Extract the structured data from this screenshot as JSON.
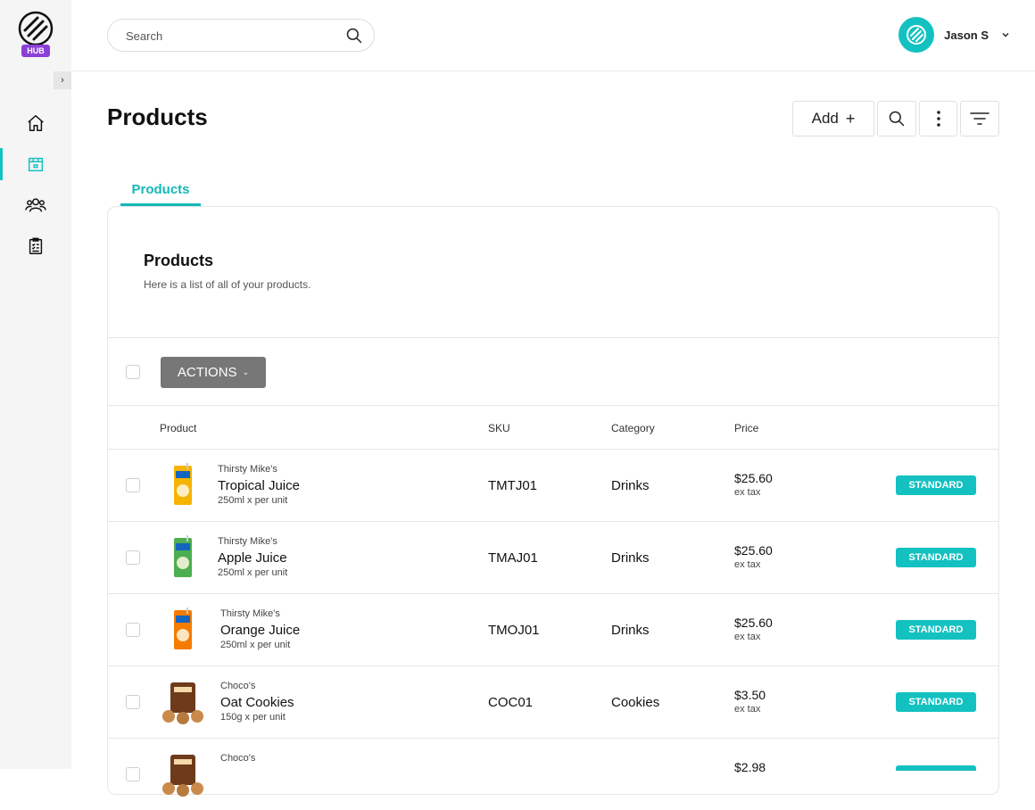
{
  "brand": {
    "logo_text": "HUB",
    "accent": "#14c1c1",
    "badge_purple": "#8b3fd6"
  },
  "sidebar": {
    "collapse_icon": "chevron-right-icon",
    "items": [
      {
        "name": "home",
        "icon": "home-icon",
        "active": false
      },
      {
        "name": "products",
        "icon": "package-icon",
        "active": true
      },
      {
        "name": "customers",
        "icon": "users-icon",
        "active": false
      },
      {
        "name": "orders",
        "icon": "clipboard-list-icon",
        "active": false
      }
    ]
  },
  "topbar": {
    "search_placeholder": "Search",
    "user_name": "Jason S"
  },
  "header": {
    "title": "Products",
    "add_label": "Add",
    "add_icon": "+"
  },
  "tabs": [
    {
      "label": "Products",
      "active": true
    }
  ],
  "card": {
    "title": "Products",
    "subtitle": "Here is a list of all of your products.",
    "actions_label": "ACTIONS",
    "columns": {
      "product": "Product",
      "sku": "SKU",
      "category": "Category",
      "price": "Price"
    }
  },
  "rows": [
    {
      "brand": "Thirsty Mike's",
      "name": "Tropical Juice",
      "unit": "250ml x per unit",
      "sku": "TMTJ01",
      "category": "Drinks",
      "price": "$25.60",
      "tax": "ex tax",
      "badge": "STANDARD",
      "thumb": "juice",
      "thumb_color": "#f4b400"
    },
    {
      "brand": "Thirsty Mike's",
      "name": "Apple Juice",
      "unit": "250ml x per unit",
      "sku": "TMAJ01",
      "category": "Drinks",
      "price": "$25.60",
      "tax": "ex tax",
      "badge": "STANDARD",
      "thumb": "juice",
      "thumb_color": "#4caf50"
    },
    {
      "brand": "Thirsty Mike's",
      "name": "Orange Juice",
      "unit": "250ml x per unit",
      "sku": "TMOJ01",
      "category": "Drinks",
      "price": "$25.60",
      "tax": "ex tax",
      "badge": "STANDARD",
      "thumb": "juice",
      "thumb_color": "#f57c00"
    },
    {
      "brand": "Choco's",
      "name": "Oat Cookies",
      "unit": "150g x per unit",
      "sku": "COC01",
      "category": "Cookies",
      "price": "$3.50",
      "tax": "ex tax",
      "badge": "STANDARD",
      "thumb": "cookies",
      "thumb_color": "#6d3b1c"
    },
    {
      "brand": "Choco's",
      "name": "",
      "unit": "",
      "sku": "",
      "category": "",
      "price": "$2.98",
      "tax": "",
      "badge": "",
      "thumb": "cookies",
      "thumb_color": "#6d3b1c"
    }
  ]
}
